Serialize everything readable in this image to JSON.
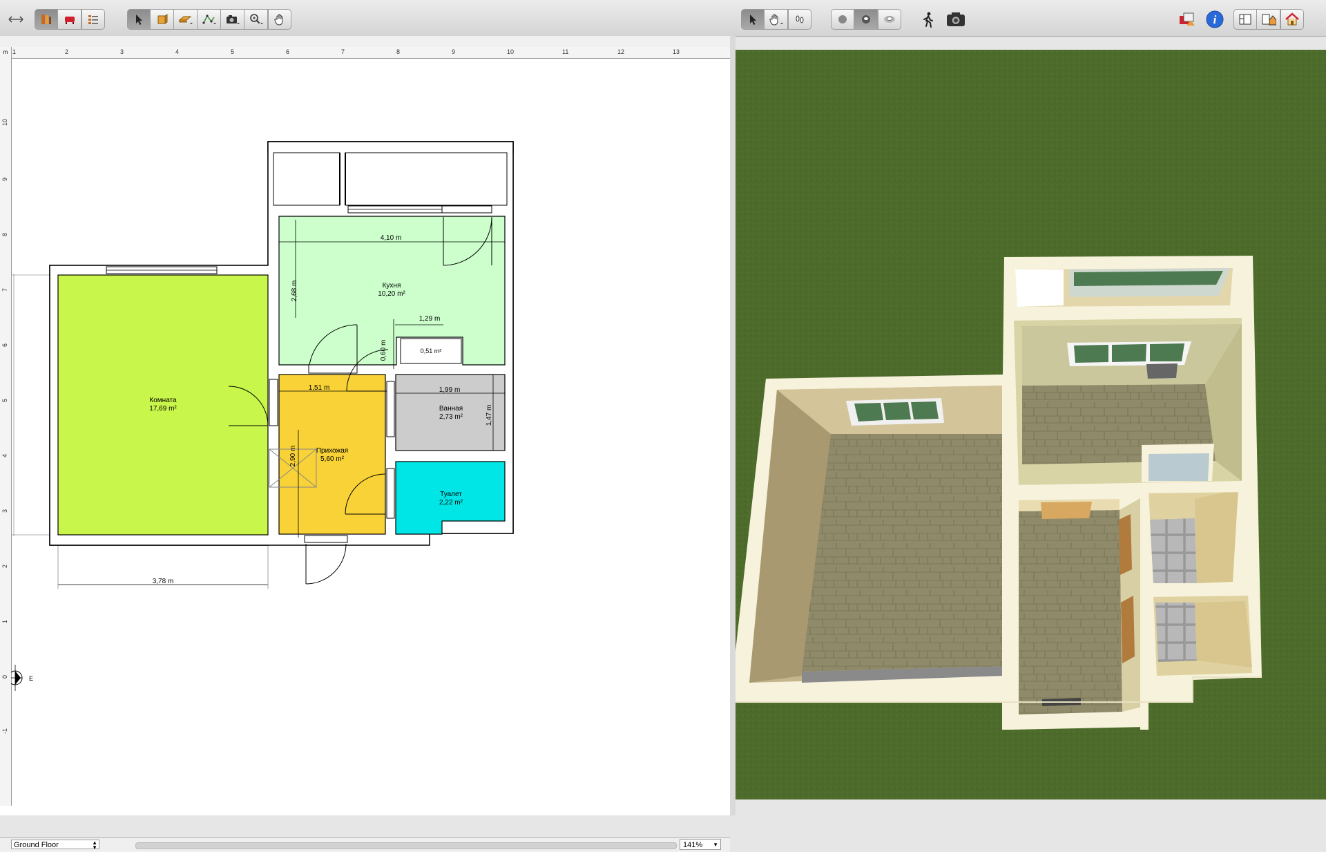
{
  "toolbar": {
    "left_tools": [
      "toggle-panels-icon",
      "catalog-icon",
      "furniture-icon",
      "list-icon"
    ],
    "plan_tools": [
      "select-icon",
      "create-walls-icon",
      "create-rooms-icon",
      "polyline-icon",
      "camera-icon",
      "zoom-icon",
      "pan-icon"
    ],
    "view_tools": [
      "select-icon",
      "pan-icon",
      "footprint-icon",
      "light-1-icon",
      "light-2-icon",
      "light-3-icon",
      "walk-icon",
      "photo-icon"
    ],
    "right_tools": [
      "furniture-catalog-icon",
      "info-icon",
      "layout-1-icon",
      "layout-2-icon",
      "home-icon"
    ]
  },
  "ruler": {
    "top": [
      "1",
      "2",
      "3",
      "4",
      "5",
      "6",
      "7",
      "8",
      "9",
      "10",
      "11",
      "12",
      "13"
    ],
    "left": [
      "10",
      "9",
      "8",
      "7",
      "6",
      "5",
      "4",
      "3",
      "2",
      "1",
      "0",
      "-1"
    ],
    "corner": "m"
  },
  "rooms": {
    "komnata": {
      "name": "Комната",
      "area": "17,69 m²"
    },
    "kuhnya": {
      "name": "Кухня",
      "area": "10,20 m²"
    },
    "prihozhaya": {
      "name": "Прихожая",
      "area": "5,60 m²"
    },
    "vannaya": {
      "name": "Ванная",
      "area": "2,73 m²"
    },
    "tualet": {
      "name": "Туалет",
      "area": "2,22 m²"
    },
    "small": {
      "area": "0,51 m²"
    }
  },
  "dimensions": {
    "kitchen_width": "4,10 m",
    "kitchen_height": "2,68 m",
    "niche_width": "1,29 m",
    "niche_height": "0,60 m",
    "hall_width": "1,51 m",
    "hall_height": "2,90 m",
    "bath_width": "1,99 m",
    "bath_height": "1,47 m",
    "room_width": "3,78 m"
  },
  "compass": {
    "label": "E"
  },
  "status": {
    "level": "Ground Floor",
    "zoom": "141%"
  },
  "colors": {
    "komnata": "#c8f64a",
    "kuhnya": "#ccffcc",
    "prihozhaya": "#f8d236",
    "vannaya": "#cccccc",
    "tualet": "#00e6e6",
    "grass": "#4d6b2a"
  }
}
